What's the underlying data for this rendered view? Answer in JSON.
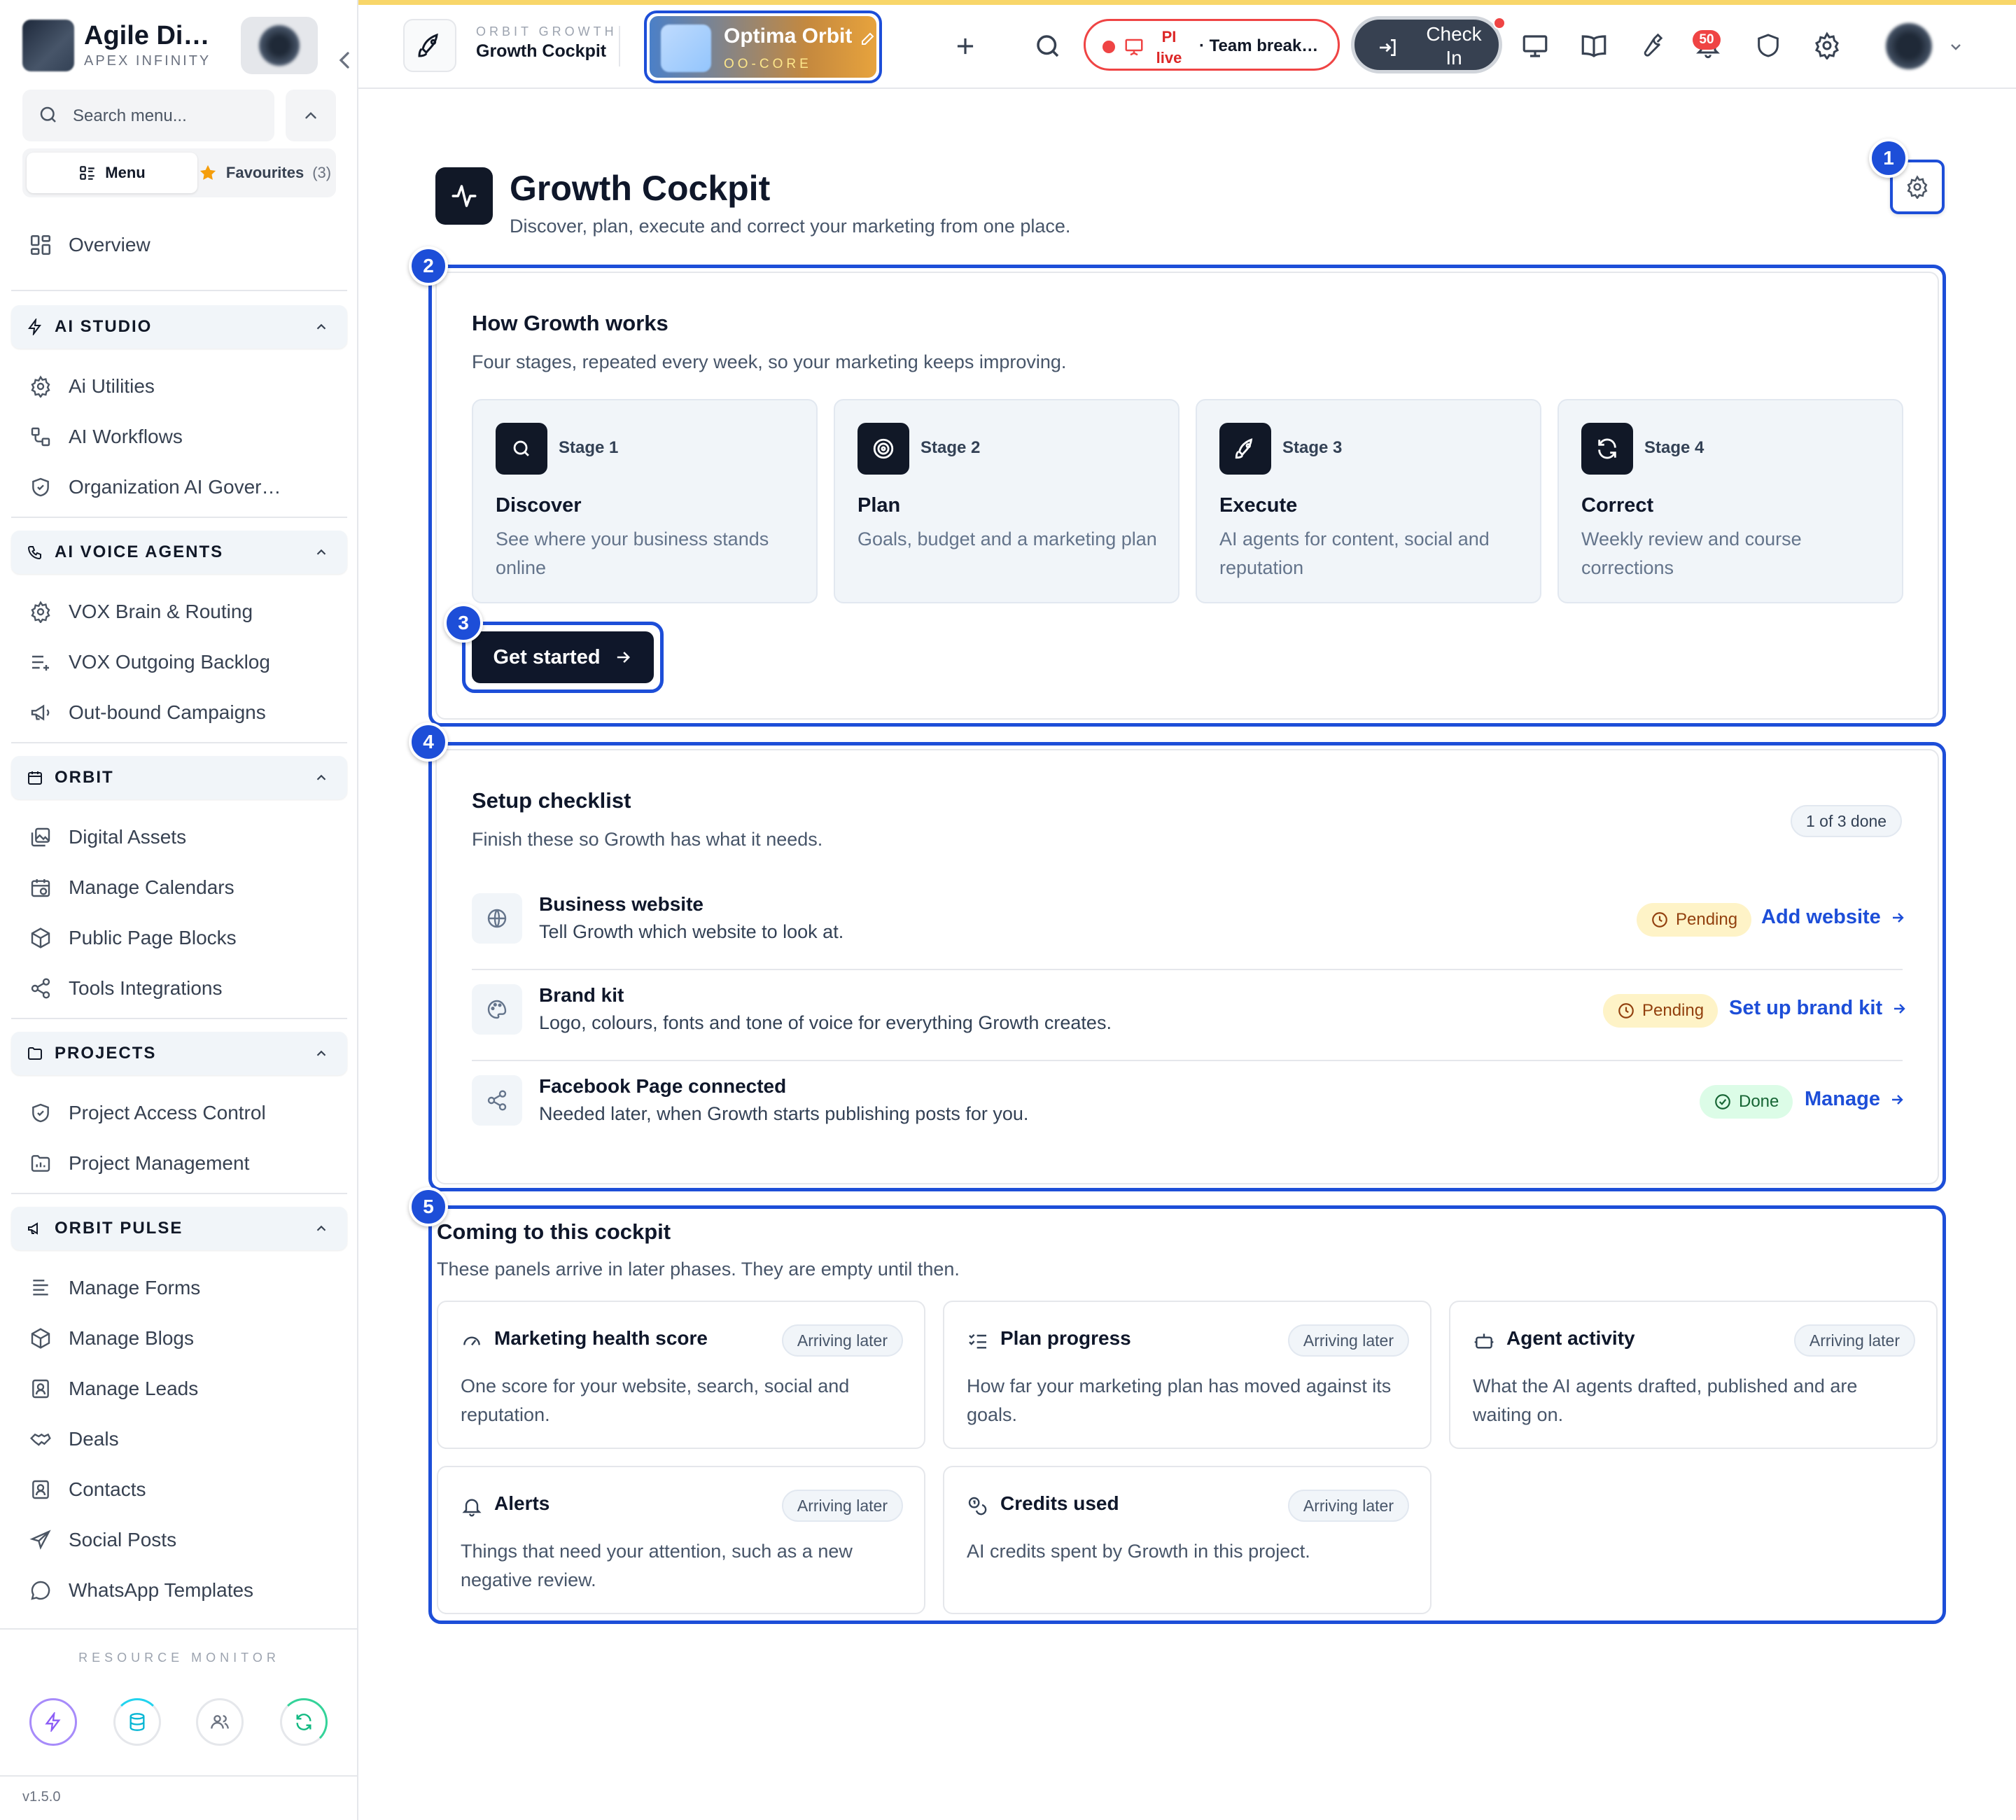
{
  "sidebar": {
    "brand_name": "Agile Di…",
    "brand_sub": "APEX INFINITY",
    "search_placeholder": "Search menu...",
    "menu_tab": "Menu",
    "favourites_tab": "Favourites",
    "favourites_count": "(3)",
    "overview": "Overview",
    "sections": [
      {
        "title": "AI STUDIO",
        "items": [
          "Ai Utilities",
          "AI Workflows",
          "Organization AI Gover…"
        ]
      },
      {
        "title": "AI VOICE AGENTS",
        "items": [
          "VOX Brain & Routing",
          "VOX Outgoing Backlog",
          "Out-bound Campaigns"
        ]
      },
      {
        "title": "ORBIT",
        "items": [
          "Digital Assets",
          "Manage Calendars",
          "Public Page Blocks",
          "Tools Integrations"
        ]
      },
      {
        "title": "PROJECTS",
        "items": [
          "Project Access Control",
          "Project Management"
        ]
      },
      {
        "title": "ORBIT PULSE",
        "items": [
          "Manage Forms",
          "Manage Blogs",
          "Manage Leads",
          "Deals",
          "Contacts",
          "Social Posts",
          "WhatsApp Templates"
        ]
      }
    ],
    "resource_monitor_title": "RESOURCE MONITOR",
    "version": "v1.5.0"
  },
  "topbar": {
    "app_kicker": "ORBIT GROWTH",
    "app_title": "Growth Cockpit",
    "org_name": "Optima Orbit",
    "org_code": "OO-CORE",
    "live_pi": "PI live",
    "live_text": "· Team break…",
    "check_in": "Check In",
    "notification_count": "50"
  },
  "page": {
    "title": "Growth Cockpit",
    "subtitle": "Discover, plan, execute and correct your marketing from one place.",
    "markers": [
      "1",
      "2",
      "3",
      "4",
      "5"
    ]
  },
  "how": {
    "title": "How Growth works",
    "subtitle": "Four stages, repeated every week, so your marketing keeps improving.",
    "stages": [
      {
        "num": "Stage 1",
        "name": "Discover",
        "desc": "See where your business stands online",
        "icon": "search-icon"
      },
      {
        "num": "Stage 2",
        "name": "Plan",
        "desc": "Goals, budget and a marketing plan",
        "icon": "target-icon"
      },
      {
        "num": "Stage 3",
        "name": "Execute",
        "desc": "AI agents for content, social and reputation",
        "icon": "rocket-icon"
      },
      {
        "num": "Stage 4",
        "name": "Correct",
        "desc": "Weekly review and course corrections",
        "icon": "refresh-icon"
      }
    ],
    "cta": "Get started"
  },
  "checklist": {
    "title": "Setup checklist",
    "subtitle": "Finish these so Growth has what it needs.",
    "progress": "1 of 3 done",
    "items": [
      {
        "title": "Business website",
        "desc": "Tell Growth which website to look at.",
        "status": "Pending",
        "action": "Add website"
      },
      {
        "title": "Brand kit",
        "desc": "Logo, colours, fonts and tone of voice for everything Growth creates.",
        "status": "Pending",
        "action": "Set up brand kit"
      },
      {
        "title": "Facebook Page connected",
        "desc": "Needed later, when Growth starts publishing posts for you.",
        "status": "Done",
        "action": "Manage"
      }
    ]
  },
  "coming": {
    "title": "Coming to this cockpit",
    "subtitle": "These panels arrive in later phases. They are empty until then.",
    "badge": "Arriving later",
    "panels": [
      {
        "title": "Marketing health score",
        "desc": "One score for your website, search, social and reputation."
      },
      {
        "title": "Plan progress",
        "desc": "How far your marketing plan has moved against its goals."
      },
      {
        "title": "Agent activity",
        "desc": "What the AI agents drafted, published and are waiting on."
      },
      {
        "title": "Alerts",
        "desc": "Things that need your attention, such as a new negative review."
      },
      {
        "title": "Credits used",
        "desc": "AI credits spent by Growth in this project."
      }
    ]
  },
  "colors": {
    "accent": "#1d4ed8",
    "dark": "#0f172a",
    "pending_bg": "#fef3c7",
    "done_bg": "#dcfce7",
    "top_accent": "#f8d66a"
  }
}
